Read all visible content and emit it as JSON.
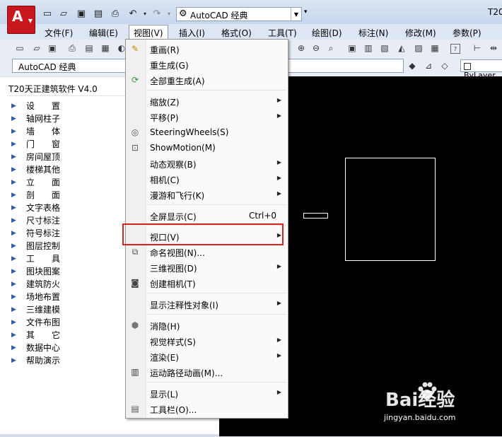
{
  "title_bar": {
    "workspace": "AutoCAD 经典",
    "window_title": "T20"
  },
  "menu_bar": [
    "文件(F)",
    "编辑(E)",
    "视图(V)",
    "插入(I)",
    "格式(O)",
    "工具(T)",
    "绘图(D)",
    "标注(N)",
    "修改(M)",
    "参数(P)"
  ],
  "toolbar": {
    "workspace": "AutoCAD 经典",
    "linetype": "ByLayer"
  },
  "palette": {
    "title": "T20天正建筑软件 V4.0",
    "items": [
      "设　　置",
      "轴网柱子",
      "墙　　体",
      "门　　窗",
      "房间屋顶",
      "楼梯其他",
      "立　　面",
      "剖　　面",
      "文字表格",
      "尺寸标注",
      "符号标注",
      "图层控制",
      "工　　具",
      "图块图案",
      "建筑防火",
      "场地布置",
      "三维建模",
      "文件布图",
      "其　　它",
      "数据中心",
      "帮助演示"
    ]
  },
  "view_menu": {
    "items": [
      {
        "label": "重画(R)",
        "icon": "pencil-icon"
      },
      {
        "label": "重生成(G)"
      },
      {
        "label": "全部重生成(A)",
        "icon": "regen-all-icon"
      },
      {
        "label": "缩放(Z)",
        "submenu": true
      },
      {
        "label": "平移(P)",
        "submenu": true
      },
      {
        "label": "SteeringWheels(S)",
        "icon": "steering-wheel-icon"
      },
      {
        "label": "ShowMotion(M)",
        "icon": "showmotion-icon"
      },
      {
        "label": "动态观察(B)",
        "submenu": true
      },
      {
        "label": "相机(C)",
        "submenu": true
      },
      {
        "label": "漫游和飞行(K)",
        "submenu": true
      },
      {
        "label": "全屏显示(C)",
        "shortcut": "Ctrl+0"
      },
      {
        "label": "视口(V)",
        "submenu": true,
        "highlighted": true
      },
      {
        "label": "命名视图(N)...",
        "icon": "named-view-icon"
      },
      {
        "label": "三维视图(D)",
        "submenu": true
      },
      {
        "label": "创建相机(T)",
        "icon": "camera-icon"
      },
      {
        "label": "显示注释性对象(I)",
        "submenu": true
      },
      {
        "label": "消隐(H)",
        "icon": "hide-icon"
      },
      {
        "label": "视觉样式(S)",
        "submenu": true
      },
      {
        "label": "渲染(E)",
        "submenu": true
      },
      {
        "label": "运动路径动画(M)...",
        "icon": "motion-path-icon"
      },
      {
        "label": "显示(L)",
        "submenu": true
      },
      {
        "label": "工具栏(O)...",
        "icon": "toolbar-icon"
      }
    ]
  },
  "highlight_color": "#d8201c",
  "watermark": {
    "logo": "Bai经验",
    "url": "jingyan.baidu.com"
  }
}
